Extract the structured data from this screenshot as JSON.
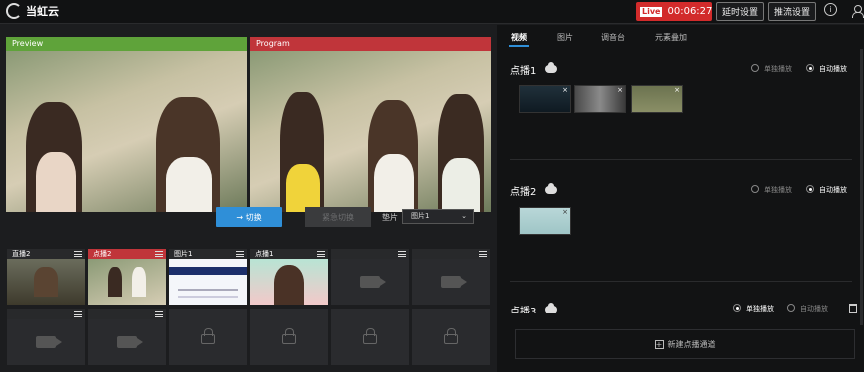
{
  "app": {
    "name": "当虹云"
  },
  "header": {
    "live_badge": "Live",
    "live_time": "00:06:27",
    "delay_settings": "延时设置",
    "stream_settings": "推流设置",
    "info_icon": "info-icon",
    "user_icon": "user-icon"
  },
  "monitors": {
    "preview": {
      "label": "Preview",
      "color": "#5fa33a"
    },
    "program": {
      "label": "Program",
      "color": "#c0353a"
    }
  },
  "controls": {
    "switch_label": "→ 切换",
    "emergency_label": "紧急切换",
    "pad_label": "垫片",
    "pad_value": "图片1"
  },
  "grid": {
    "row1": [
      "直播2",
      "点播2",
      "图片1",
      "点播1",
      "",
      ""
    ],
    "active_index": 1
  },
  "right": {
    "tabs": [
      "视频",
      "图片",
      "调音台",
      "元素叠加"
    ],
    "active_tab": 0,
    "channels": [
      {
        "title": "点播1",
        "single": "单独播放",
        "auto": "自动播放",
        "selected": "auto"
      },
      {
        "title": "点播2",
        "single": "单独播放",
        "auto": "自动播放",
        "selected": "auto"
      },
      {
        "title": "点播3",
        "single": "单独播放",
        "auto": "自动播放",
        "selected": "single"
      }
    ],
    "new_channel": "新建点播通道"
  },
  "colors": {
    "accent": "#2f8fd8",
    "live": "#d22b2b",
    "preview": "#5fa33a",
    "program": "#c0353a"
  }
}
